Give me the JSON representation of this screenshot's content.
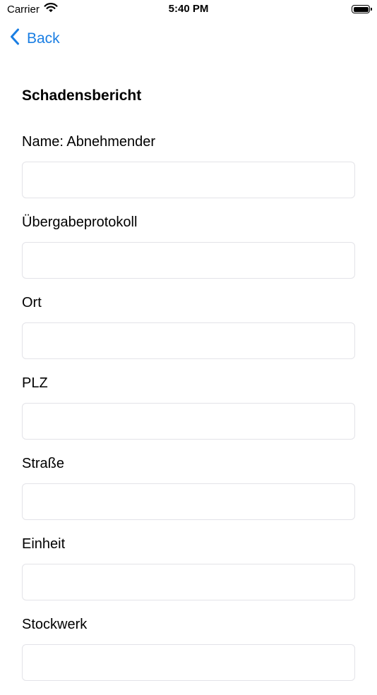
{
  "status_bar": {
    "carrier": "Carrier",
    "time": "5:40 PM",
    "wifi_icon": "wifi-icon",
    "battery_icon": "battery-icon"
  },
  "nav": {
    "back_label": "Back",
    "back_icon": "chevron-left-icon",
    "accent_color": "#1a7ee3"
  },
  "form": {
    "title": "Schadensbericht",
    "fields": [
      {
        "label": "Name: Abnehmender",
        "value": "",
        "placeholder": ""
      },
      {
        "label": "Übergabeprotokoll",
        "value": "",
        "placeholder": ""
      },
      {
        "label": "Ort",
        "value": "",
        "placeholder": ""
      },
      {
        "label": "PLZ",
        "value": "",
        "placeholder": ""
      },
      {
        "label": "Straße",
        "value": "",
        "placeholder": ""
      },
      {
        "label": "Einheit",
        "value": "",
        "placeholder": ""
      },
      {
        "label": "Stockwerk",
        "value": "",
        "placeholder": ""
      }
    ]
  }
}
